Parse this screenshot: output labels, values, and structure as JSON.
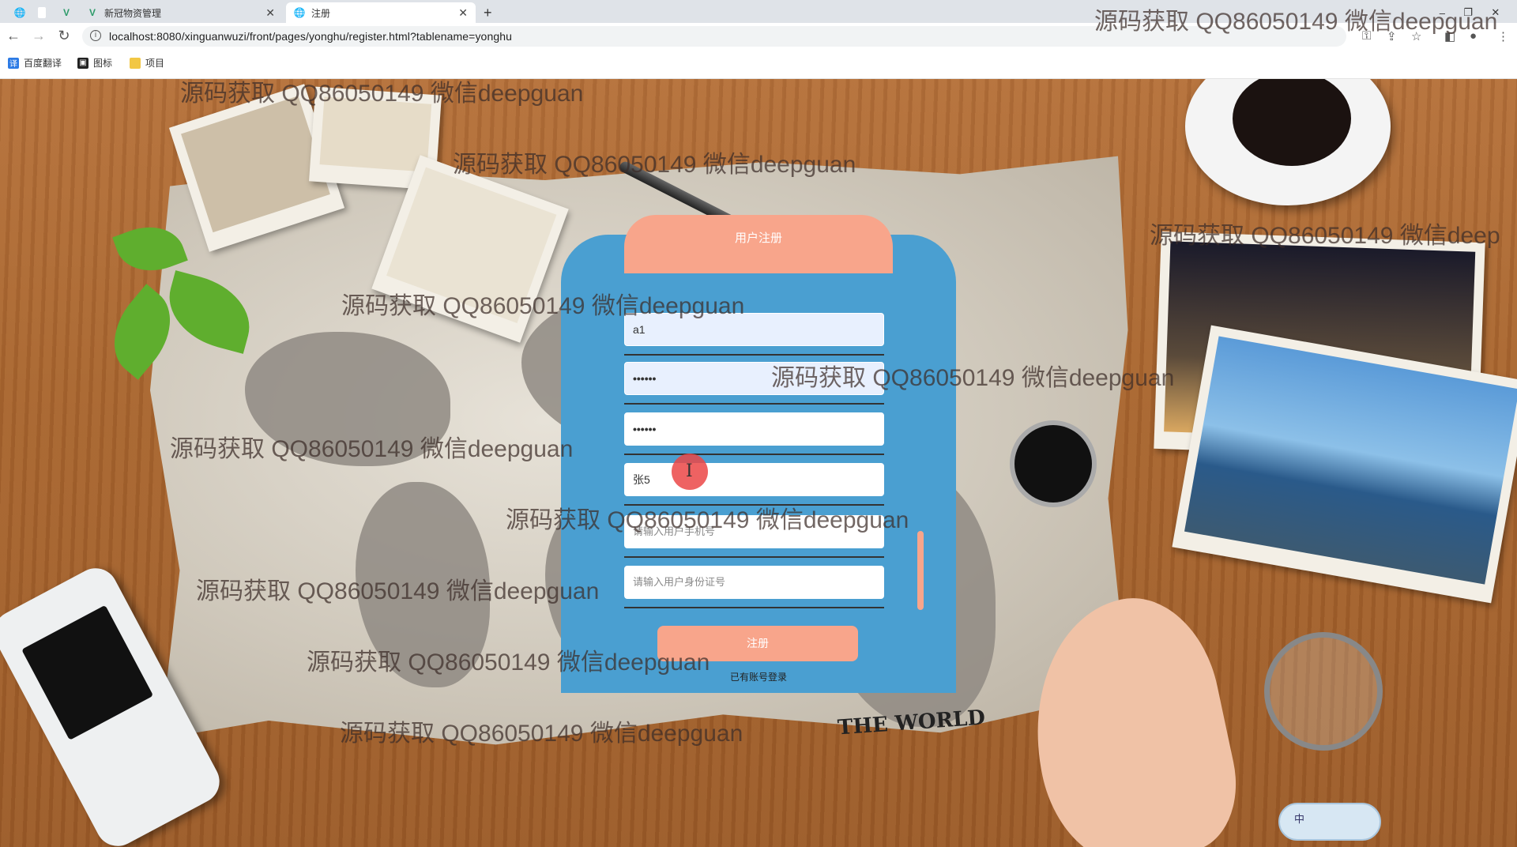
{
  "browser": {
    "tabs": [
      {
        "label": ""
      },
      {
        "label": ""
      },
      {
        "label": ""
      },
      {
        "label": "新冠物资管理"
      },
      {
        "label": "注册"
      }
    ],
    "url": "localhost:8080/xinguanwuzi/front/pages/yonghu/register.html?tablename=yonghu",
    "bookmarks": [
      {
        "label": "百度翻译"
      },
      {
        "label": "图标"
      },
      {
        "label": "项目"
      }
    ]
  },
  "scene": {
    "world_label": "THE WORLD"
  },
  "form": {
    "title": "用户注册",
    "fields": [
      {
        "value": "a1",
        "placeholder": ""
      },
      {
        "value": "••••••",
        "placeholder": ""
      },
      {
        "value": "••••••",
        "placeholder": ""
      },
      {
        "value": "张5",
        "placeholder": ""
      },
      {
        "value": "",
        "placeholder": "请输入用户手机号"
      },
      {
        "value": "",
        "placeholder": "请输入用户身份证号"
      }
    ],
    "submit_label": "注册",
    "login_link": "已有账号登录"
  },
  "ime": {
    "label": "中"
  },
  "watermark": "源码获取 QQ86050149 微信deepguan",
  "watermark_right": "源码获取 QQ86050149 微信deep"
}
